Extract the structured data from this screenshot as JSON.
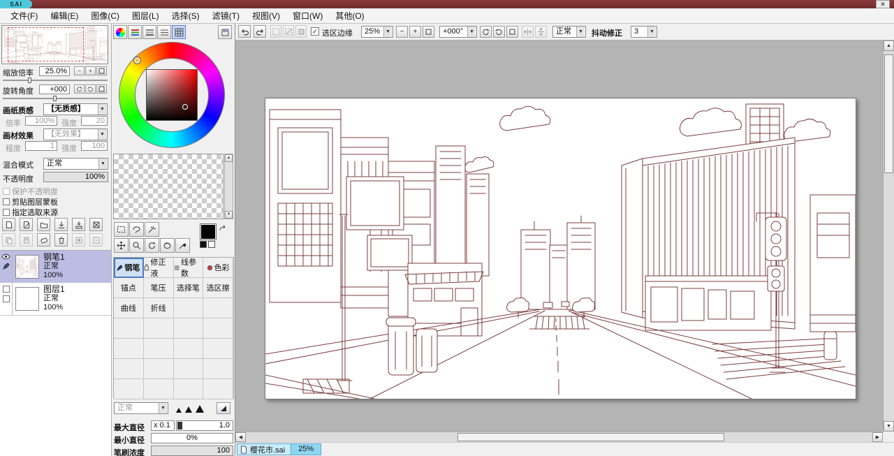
{
  "titlebar": {
    "logo_text": "SAI"
  },
  "menubar": {
    "items": [
      "文件(F)",
      "编辑(E)",
      "图像(C)",
      "图层(L)",
      "选择(S)",
      "滤镜(T)",
      "视图(V)",
      "窗口(W)",
      "其他(O)"
    ]
  },
  "toolbar": {
    "selection_edge": "选区边缘",
    "zoom": "25%",
    "angle": "+000°",
    "mode": "正常",
    "stabilizer_label": "抖动修正",
    "stabilizer": "3"
  },
  "navigator": {
    "zoom_label": "缩放倍率",
    "zoom_value": "25.0%",
    "angle_label": "旋转角度",
    "angle_value": "+000"
  },
  "paper": {
    "texture_label": "画纸质感",
    "texture_value": "【无质感】",
    "scale_label": "倍率",
    "scale_value": "100%",
    "strength_label": "强度",
    "strength_value": "20",
    "material_label": "画材效果",
    "material_value": "【无效果】",
    "degree_label": "程度",
    "degree_value": "1",
    "strength2_label": "强度",
    "strength2_value": "100"
  },
  "layers": {
    "blend_label": "混合模式",
    "blend_value": "正常",
    "opacity_label": "不透明度",
    "opacity_value": "100%",
    "options": [
      "保护不透明度",
      "剪贴图层蒙板",
      "指定选取来源"
    ],
    "items": [
      {
        "name": "钢笔1",
        "mode": "正常",
        "opacity": "100%"
      },
      {
        "name": "图层1",
        "mode": "正常",
        "opacity": "100%"
      }
    ]
  },
  "tools": {
    "cells": [
      "钢笔",
      "修正液",
      "线参数",
      "色彩",
      "锚点",
      "笔压",
      "选择笔",
      "选区擦",
      "曲线",
      "折线"
    ],
    "mode_value": "正常",
    "max_label": "最大直径",
    "max_mult": "x 0.1",
    "max_value": "1.0",
    "min_label": "最小直径",
    "min_value": "0%",
    "density_label": "笔刷浓度",
    "density_value": "100"
  },
  "statusbar": {
    "doc_name": "樱花市.sai",
    "doc_zoom": "25%"
  },
  "icons": {
    "dropdown_arrow": "▼",
    "spin_up": "▲",
    "spin_down": "▼",
    "scroll_up": "▲",
    "scroll_down": "▼",
    "scroll_left": "◀",
    "scroll_right": "▶",
    "close": "✕",
    "check": "✓",
    "minus": "−",
    "plus": "+"
  },
  "colors": {
    "line_art": "#7b3c3c",
    "selected_layer": "#bdbde4",
    "tab_blue": "#8ed7f2"
  }
}
